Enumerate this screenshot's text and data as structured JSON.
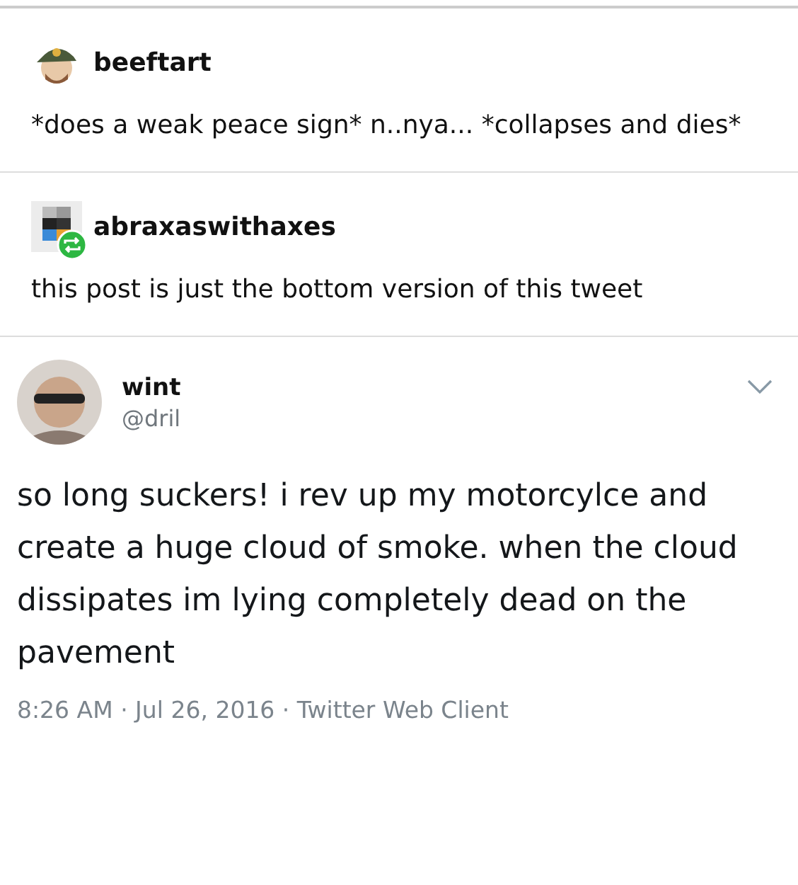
{
  "posts": [
    {
      "username": "beeftart",
      "reblog": false,
      "text": "*does a weak peace sign* n..nya... *collapses and dies*"
    },
    {
      "username": "abraxaswithaxes",
      "reblog": true,
      "text": "this post is just the bottom version of this tweet"
    }
  ],
  "tweet": {
    "name": "wint",
    "handle": "@dril",
    "text": "so long suckers! i rev up my motorcylce and create a huge cloud of smoke. when the cloud dissipates im lying completely dead on the pavement",
    "meta": "8:26 AM · Jul 26, 2016 · Twitter Web Client"
  }
}
